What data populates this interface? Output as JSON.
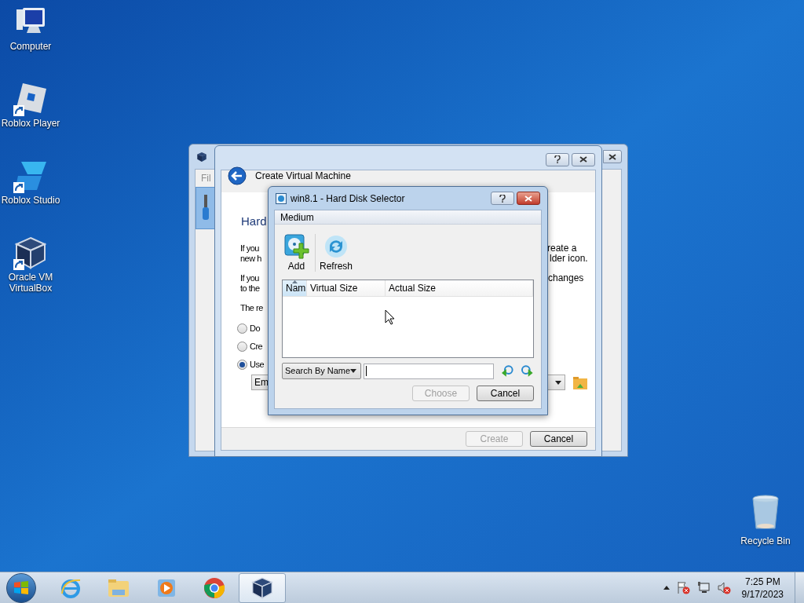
{
  "desktop_icons": [
    {
      "label": "Computer",
      "kind": "computer",
      "shortcut": false
    },
    {
      "label": "Roblox Player",
      "kind": "player",
      "shortcut": true
    },
    {
      "label": "Roblox Studio",
      "kind": "studio",
      "shortcut": true
    },
    {
      "label": "Oracle VM VirtualBox",
      "kind": "vbox",
      "shortcut": true
    }
  ],
  "recycle_bin": {
    "label": "Recycle Bin"
  },
  "main_window": {
    "menu_fragment": "Fil"
  },
  "wizard": {
    "title": "Create Virtual Machine",
    "heading_fragment": "Hard",
    "left_fragments": [
      "If you",
      "new h",
      "If you",
      "to the",
      "The re"
    ],
    "right_fragments": [
      "reate a",
      "lder icon.",
      "changes"
    ],
    "radios": [
      {
        "label": "Do",
        "selected": false
      },
      {
        "label": "Cre",
        "selected": false
      },
      {
        "label": "Use",
        "selected": true
      }
    ],
    "combo_fragment": "Em",
    "buttons": [
      {
        "label": "Create",
        "disabled": true
      },
      {
        "label": "Cancel",
        "disabled": false
      }
    ]
  },
  "dialog": {
    "title": "win8.1 - Hard Disk Selector",
    "section": "Medium",
    "tools": [
      {
        "label": "Add",
        "kind": "add"
      },
      {
        "label": "Refresh",
        "kind": "refresh"
      }
    ],
    "columns": [
      {
        "label": "Nam",
        "sorted": true
      },
      {
        "label": "Virtual Size",
        "sorted": false
      },
      {
        "label": "Actual Size",
        "sorted": false
      }
    ],
    "search_mode": "Search By Name",
    "buttons": [
      {
        "label": "Choose",
        "disabled": true
      },
      {
        "label": "Cancel",
        "disabled": false
      }
    ]
  },
  "taskbar": {
    "apps": [
      {
        "kind": "ie",
        "active": false
      },
      {
        "kind": "explorer",
        "active": false
      },
      {
        "kind": "media",
        "active": false
      },
      {
        "kind": "chrome",
        "active": false
      },
      {
        "kind": "vbox",
        "active": true
      }
    ],
    "time": "7:25 PM",
    "date": "9/17/2023"
  }
}
